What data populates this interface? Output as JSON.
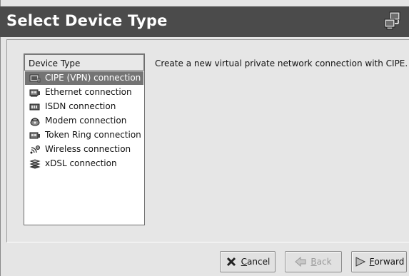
{
  "header": {
    "title": "Select Device Type",
    "icon": "network-device-icon"
  },
  "list": {
    "column_header": "Device Type",
    "items": [
      {
        "label": "CIPE (VPN) connection",
        "icon": "vpn-icon",
        "selected": true
      },
      {
        "label": "Ethernet connection",
        "icon": "ethernet-card-icon",
        "selected": false
      },
      {
        "label": "ISDN connection",
        "icon": "isdn-card-icon",
        "selected": false
      },
      {
        "label": "Modem connection",
        "icon": "modem-icon",
        "selected": false
      },
      {
        "label": "Token Ring connection",
        "icon": "token-ring-card-icon",
        "selected": false
      },
      {
        "label": "Wireless connection",
        "icon": "wireless-icon",
        "selected": false
      },
      {
        "label": "xDSL connection",
        "icon": "xdsl-icon",
        "selected": false
      }
    ]
  },
  "description": "Create a new virtual private network connection with CIPE.",
  "buttons": {
    "cancel": {
      "mnemonic": "C",
      "rest": "ancel",
      "enabled": true
    },
    "back": {
      "mnemonic": "B",
      "rest": "ack",
      "enabled": false
    },
    "forward": {
      "mnemonic": "F",
      "rest": "orward",
      "enabled": true
    }
  },
  "colors": {
    "header_bg": "#4b4b4b",
    "selection_bg": "#747474"
  }
}
